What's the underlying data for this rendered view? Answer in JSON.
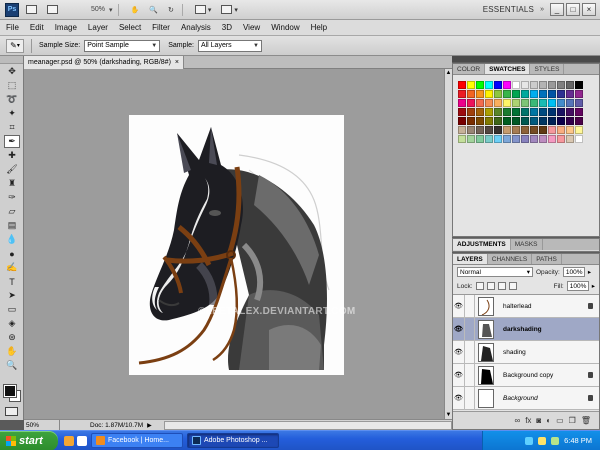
{
  "app": {
    "logo": "Ps",
    "zoom": "50%",
    "workspace": "ESSENTIALS",
    "window_controls": [
      "_",
      "□",
      "×"
    ]
  },
  "menu": [
    "File",
    "Edit",
    "Image",
    "Layer",
    "Select",
    "Filter",
    "Analysis",
    "3D",
    "View",
    "Window",
    "Help"
  ],
  "options_bar": {
    "tool_icon": "eyedropper-icon",
    "sample_size_label": "Sample Size:",
    "sample_size_value": "Point Sample",
    "sample_label": "Sample:",
    "sample_value": "All Layers"
  },
  "document": {
    "tab_title": "meanager.psd @ 50% (darkshading, RGB/8#)",
    "tab_close": "×",
    "watermark": "©LEETALEX.DEVIANTART.COM",
    "status_zoom": "50%",
    "status_doc": "Doc: 1.87M/10.7M"
  },
  "panels": {
    "color_tabs": [
      "COLOR",
      "SWATCHES",
      "STYLES"
    ],
    "active_color_tab": "SWATCHES",
    "adjust_tabs": [
      "ADJUSTMENTS",
      "MASKS"
    ],
    "layer_tabs": [
      "LAYERS",
      "CHANNELS",
      "PATHS"
    ],
    "blend_mode": "Normal",
    "opacity_label": "Opacity:",
    "opacity_value": "100%",
    "lock_label": "Lock:",
    "fill_label": "Fill:",
    "fill_value": "100%",
    "layers": [
      {
        "name": "halterlead",
        "selected": false,
        "italic": false,
        "locked": true
      },
      {
        "name": "darkshading",
        "selected": true,
        "italic": false,
        "locked": false
      },
      {
        "name": "shading",
        "selected": false,
        "italic": false,
        "locked": false
      },
      {
        "name": "Background copy",
        "selected": false,
        "italic": false,
        "locked": true
      },
      {
        "name": "Background",
        "selected": false,
        "italic": true,
        "locked": true
      }
    ],
    "layer_bottom_icons": [
      "link-icon",
      "fx-icon",
      "mask-icon",
      "adjustment-icon",
      "group-icon",
      "new-layer-icon",
      "trash-icon"
    ]
  },
  "swatch_colors": [
    "#ff0000",
    "#ffff00",
    "#00ff00",
    "#00ffff",
    "#0000ff",
    "#ff00ff",
    "#ffffff",
    "#e6e6e6",
    "#cccccc",
    "#b3b3b3",
    "#999999",
    "#808080",
    "#666666",
    "#000000",
    "#ed1c24",
    "#f26522",
    "#f7941d",
    "#fff200",
    "#8dc63f",
    "#39b54a",
    "#00a651",
    "#00a99d",
    "#00aeef",
    "#0072bc",
    "#0054a6",
    "#2e3192",
    "#662d91",
    "#92278f",
    "#ec008c",
    "#ed145b",
    "#f26c4f",
    "#f68e56",
    "#fbaf5d",
    "#fff568",
    "#acd373",
    "#7cc576",
    "#3bb878",
    "#1abbb4",
    "#00bff3",
    "#438ccb",
    "#5574b9",
    "#605ca8",
    "#9e0b0f",
    "#a0410d",
    "#a36209",
    "#aba000",
    "#598527",
    "#1a7b30",
    "#007236",
    "#00746b",
    "#0076a3",
    "#004b80",
    "#003471",
    "#1b1464",
    "#440e62",
    "#630460",
    "#790000",
    "#7b2e00",
    "#7d4900",
    "#827b00",
    "#406618",
    "#005e20",
    "#005826",
    "#005952",
    "#005b7f",
    "#003663",
    "#002157",
    "#0d004c",
    "#32004b",
    "#4b0049",
    "#c7b299",
    "#998675",
    "#736357",
    "#534741",
    "#37302d",
    "#c69c6d",
    "#a67c52",
    "#8c6239",
    "#754c24",
    "#603913",
    "#f5989d",
    "#f9ad81",
    "#fdc689",
    "#fff799",
    "#c4df9b",
    "#a3d39c",
    "#82ca9c",
    "#7accc8",
    "#6dcff6",
    "#7da7d8",
    "#8393ca",
    "#8781bd",
    "#a187be",
    "#bd8cbf",
    "#f49ac1",
    "#f6989d",
    "#d9c7b1",
    "#ffffff"
  ],
  "taskbar": {
    "start_label": "start",
    "buttons": [
      "Facebook | Home...",
      "Adobe Photoshop ..."
    ],
    "clock": "6:48 PM"
  }
}
